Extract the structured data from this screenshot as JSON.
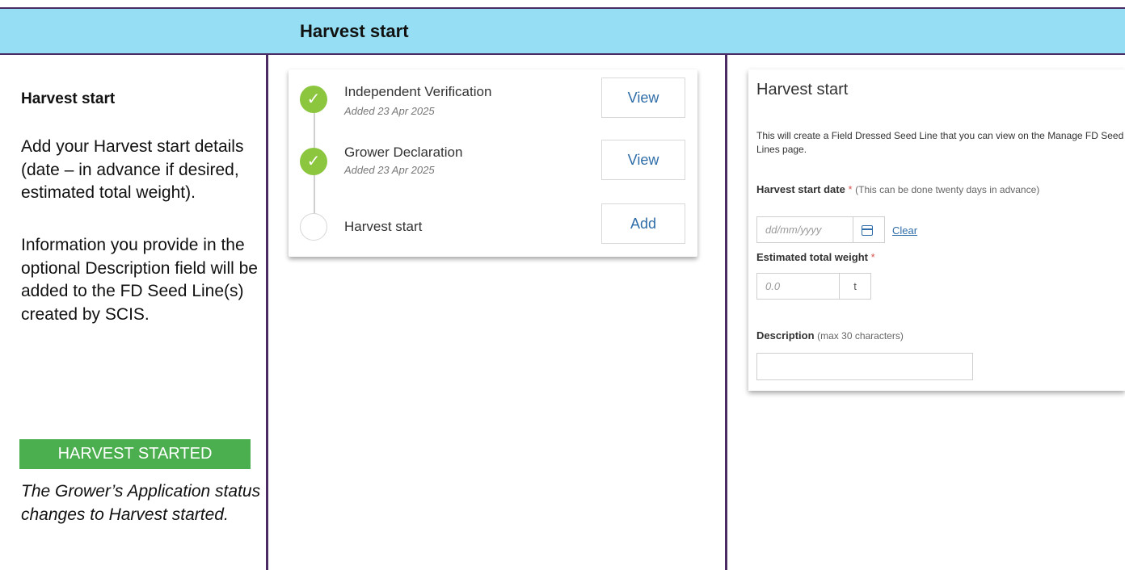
{
  "banner": {
    "title": "Harvest start"
  },
  "left": {
    "heading": "Harvest start",
    "paragraph1": "Add your Harvest start details (date – in advance if desired, estimated total weight).",
    "paragraph2": "Information you provide in the optional Description field will be added to the FD Seed Line(s) created by SCIS.",
    "status_label": "HARVEST STARTED",
    "status_color": "#4caf4f",
    "status_note": "The Grower’s Application status changes to Harvest started."
  },
  "timeline": {
    "items": [
      {
        "title": "Independent Verification",
        "subtitle": "Added 23 Apr 2025",
        "button": "View",
        "completed": true,
        "icon": "check-icon"
      },
      {
        "title": "Grower Declaration",
        "subtitle": "Added 23 Apr 2025",
        "button": "View",
        "completed": true,
        "icon": "check-icon"
      },
      {
        "title": "Harvest start",
        "subtitle": "",
        "button": "Add",
        "completed": false,
        "icon": "empty-circle-icon"
      }
    ]
  },
  "form": {
    "title": "Harvest start",
    "intro": "This will create a Field Dressed Seed Line that you can view on the Manage FD Seed Lines page.",
    "date_label": "Harvest start date",
    "required_mark": "*",
    "date_hint": "(This can be done twenty days in advance)",
    "date_placeholder": "dd/mm/yyyy",
    "clear_link": "Clear",
    "weight_label": "Estimated total weight",
    "weight_placeholder": "0.0",
    "weight_unit": "t",
    "description_label": "Description",
    "description_hint": "(max 30 characters)",
    "description_value": ""
  }
}
